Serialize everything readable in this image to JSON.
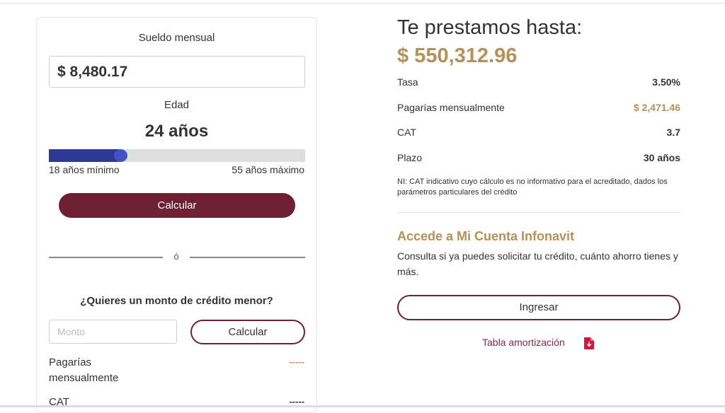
{
  "calculator": {
    "salary_label": "Sueldo mensual",
    "salary_value": "$ 8,480.17",
    "age_label": "Edad",
    "age_value": "24 años",
    "age_slider": {
      "min": 18,
      "max": 55,
      "value": 24
    },
    "min_label": "18 años mínimo",
    "max_label": "55 años máximo",
    "calc_button": "Calcular",
    "divider_text": "ó",
    "less_title": "¿Quieres un monto de crédito menor?",
    "monto_placeholder": "Monto",
    "calc_button_2": "Calcular",
    "rows": [
      {
        "label": "Pagarías mensualmente",
        "value": "-----",
        "color": "#b59159"
      },
      {
        "label": "CAT",
        "value": "-----",
        "color": "#333333"
      }
    ]
  },
  "result": {
    "title": "Te prestamos hasta:",
    "amount": "$ 550,312.96",
    "rows": [
      {
        "label": "Tasa",
        "value": "3.50%"
      },
      {
        "label": "Pagarías mensualmente",
        "value": "$ 2,471.46"
      },
      {
        "label": "CAT",
        "value": "3.7"
      },
      {
        "label": "Plazo",
        "value": "30 años"
      }
    ],
    "note": "NI: CAT indicativo cuyo cálculo es no informativo para el acreditado, dados los parámetros particulares del crédito"
  },
  "access": {
    "title": "Accede a Mi Cuenta Infonavit",
    "description": "Consulta si ya puedes solicitar tu crédito, cuánto ahorro tienes y más.",
    "button": "Ingresar",
    "link": "Tabla amortización",
    "link_icon": "pdf-download-icon"
  },
  "colors": {
    "primary": "#6e1f33",
    "gold": "#b59159",
    "slider": "#2c3993",
    "link": "#8a2444"
  }
}
